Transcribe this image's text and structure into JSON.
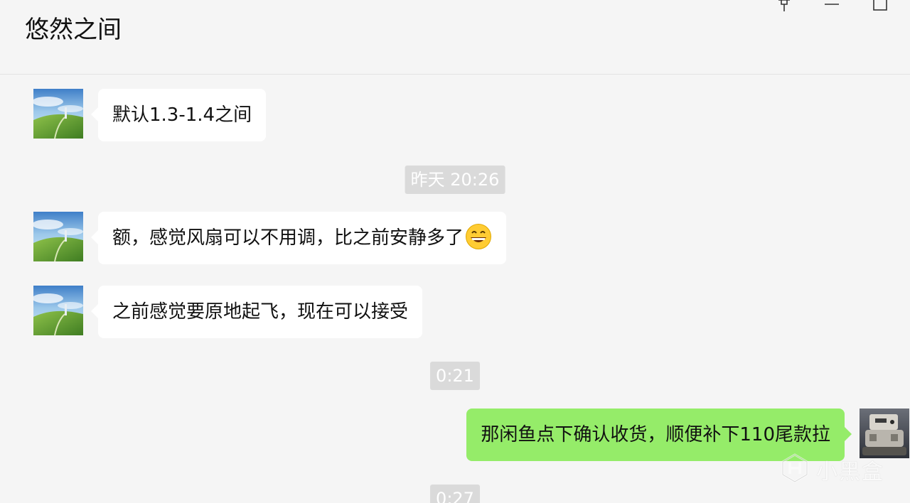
{
  "window": {
    "title": "悠然之间",
    "controls": [
      {
        "name": "pin-icon"
      },
      {
        "name": "minimize-icon"
      },
      {
        "name": "maximize-icon"
      }
    ]
  },
  "messages": [
    {
      "type": "incoming",
      "text": "默认1.3-1.4之间",
      "avatar": "landscape-avatar-icon"
    },
    {
      "type": "timestamp",
      "text": "昨天 20:26"
    },
    {
      "type": "incoming",
      "text": "额，感觉风扇可以不用调，比之前安静多了",
      "emoji": "grinning-face-icon",
      "avatar": "landscape-avatar-icon"
    },
    {
      "type": "incoming",
      "text": "之前感觉要原地起飞，现在可以接受",
      "avatar": "landscape-avatar-icon"
    },
    {
      "type": "timestamp",
      "text": "0:21"
    },
    {
      "type": "outgoing",
      "text": "那闲鱼点下确认收货，顺便补下110尾款拉",
      "avatar": "robot-avatar-icon"
    },
    {
      "type": "timestamp",
      "text": "0:27"
    }
  ],
  "watermark": {
    "text": "小黑盒",
    "icon": "heybox-logo-icon"
  },
  "colors": {
    "background": "#f5f5f5",
    "incoming_bubble": "#ffffff",
    "outgoing_bubble": "#95ec69",
    "timestamp_pill": "#dadada",
    "timestamp_text": "#ffffff"
  }
}
